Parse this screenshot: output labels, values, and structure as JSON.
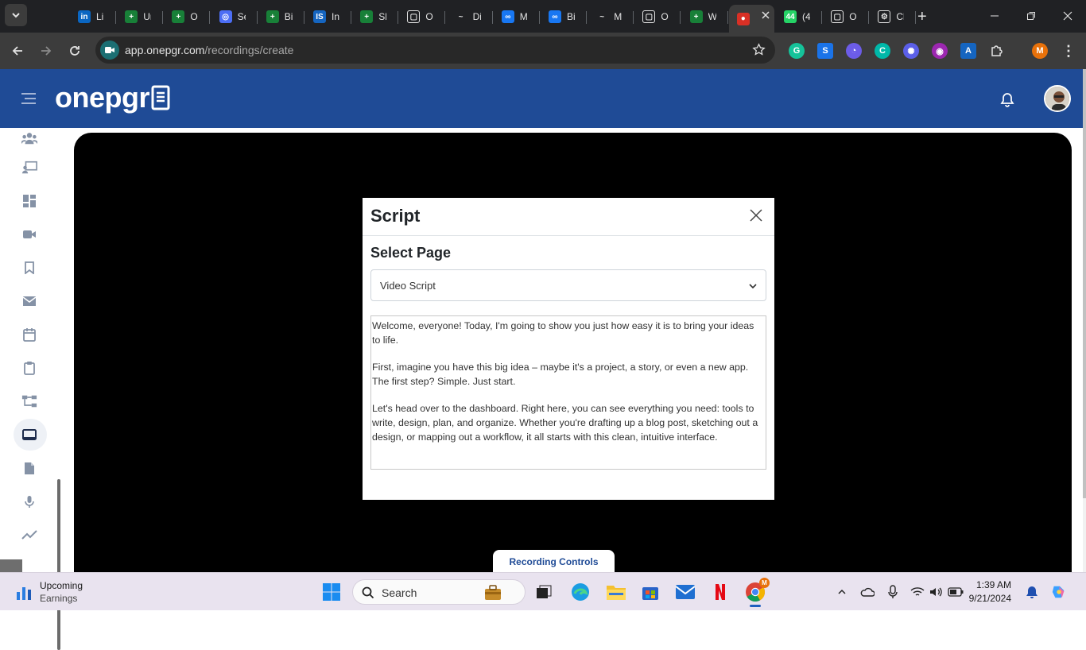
{
  "browser": {
    "tabs": [
      {
        "fav": "in",
        "color": "#0a66c2",
        "title": "LinkedIn"
      },
      {
        "fav": "+",
        "color": "#188038",
        "title": "Ur"
      },
      {
        "fav": "+",
        "color": "#188038",
        "title": "Or"
      },
      {
        "fav": "◎",
        "color": "#4c6ef5",
        "title": "Se"
      },
      {
        "fav": "+",
        "color": "#188038",
        "title": "Bi"
      },
      {
        "fav": "IS",
        "color": "#1565c0",
        "title": "Int"
      },
      {
        "fav": "+",
        "color": "#188038",
        "title": "Sh"
      },
      {
        "fav": "▢",
        "color": "#ffffff",
        "title": "Or"
      },
      {
        "fav": "~",
        "color": "#202124",
        "title": "Di"
      },
      {
        "fav": "∞",
        "color": "#1877f2",
        "title": "M"
      },
      {
        "fav": "∞",
        "color": "#1877f2",
        "title": "Bi"
      },
      {
        "fav": "~",
        "color": "#202124",
        "title": "My"
      },
      {
        "fav": "▢",
        "color": "#ffffff",
        "title": "Or"
      },
      {
        "fav": "+",
        "color": "#188038",
        "title": "W"
      },
      {
        "fav": "●",
        "color": "#d93025",
        "title": "",
        "active": true
      },
      {
        "fav": "44",
        "color": "#25d366",
        "title": "(4"
      },
      {
        "fav": "▢",
        "color": "#ffffff",
        "title": "Or"
      },
      {
        "fav": "⚙",
        "color": "#ffffff",
        "title": "Ch"
      }
    ],
    "new_tab_label": "+",
    "url_host": "app.onepgr.com",
    "url_path": "/recordings/create",
    "profile_initial": "M"
  },
  "app": {
    "brand": "onepgr",
    "colors": {
      "header": "#1f4b96",
      "accent": "#1f4b96"
    }
  },
  "sidebar": {
    "items": [
      {
        "icon": "users-icon",
        "active": false
      },
      {
        "icon": "presentation-icon",
        "active": false
      },
      {
        "icon": "dashboard-icon",
        "active": false
      },
      {
        "icon": "video-camera-icon",
        "active": false
      },
      {
        "icon": "bookmark-icon",
        "active": false
      },
      {
        "icon": "mail-icon",
        "active": false
      },
      {
        "icon": "calendar-icon",
        "active": false
      },
      {
        "icon": "clipboard-icon",
        "active": false
      },
      {
        "icon": "workflow-icon",
        "active": false
      },
      {
        "icon": "screen-icon",
        "active": true
      },
      {
        "icon": "file-icon",
        "active": false
      },
      {
        "icon": "microphone-icon",
        "active": false
      },
      {
        "icon": "analytics-icon",
        "active": false
      }
    ]
  },
  "modal": {
    "title": "Script",
    "select_label": "Select Page",
    "selected_page": "Video Script",
    "script_paragraphs": [
      "Welcome, everyone! Today, I'm going to show you just how easy it is to bring your ideas to life.",
      "First, imagine you have this big idea – maybe it's a project, a story, or even a new app. The first step? Simple. Just start.",
      "Let's head over to the dashboard. Right here, you can see everything you need: tools to write, design, plan, and organize. Whether you're drafting up a blog post, sketching out a design, or mapping out a workflow, it all starts with this clean, intuitive interface."
    ]
  },
  "recording_controls_label": "Recording Controls",
  "taskbar": {
    "weather_title": "Upcoming",
    "weather_subtitle": "Earnings",
    "search_label": "Search",
    "time": "1:39 AM",
    "date": "9/21/2024",
    "chrome_badge": "M"
  }
}
